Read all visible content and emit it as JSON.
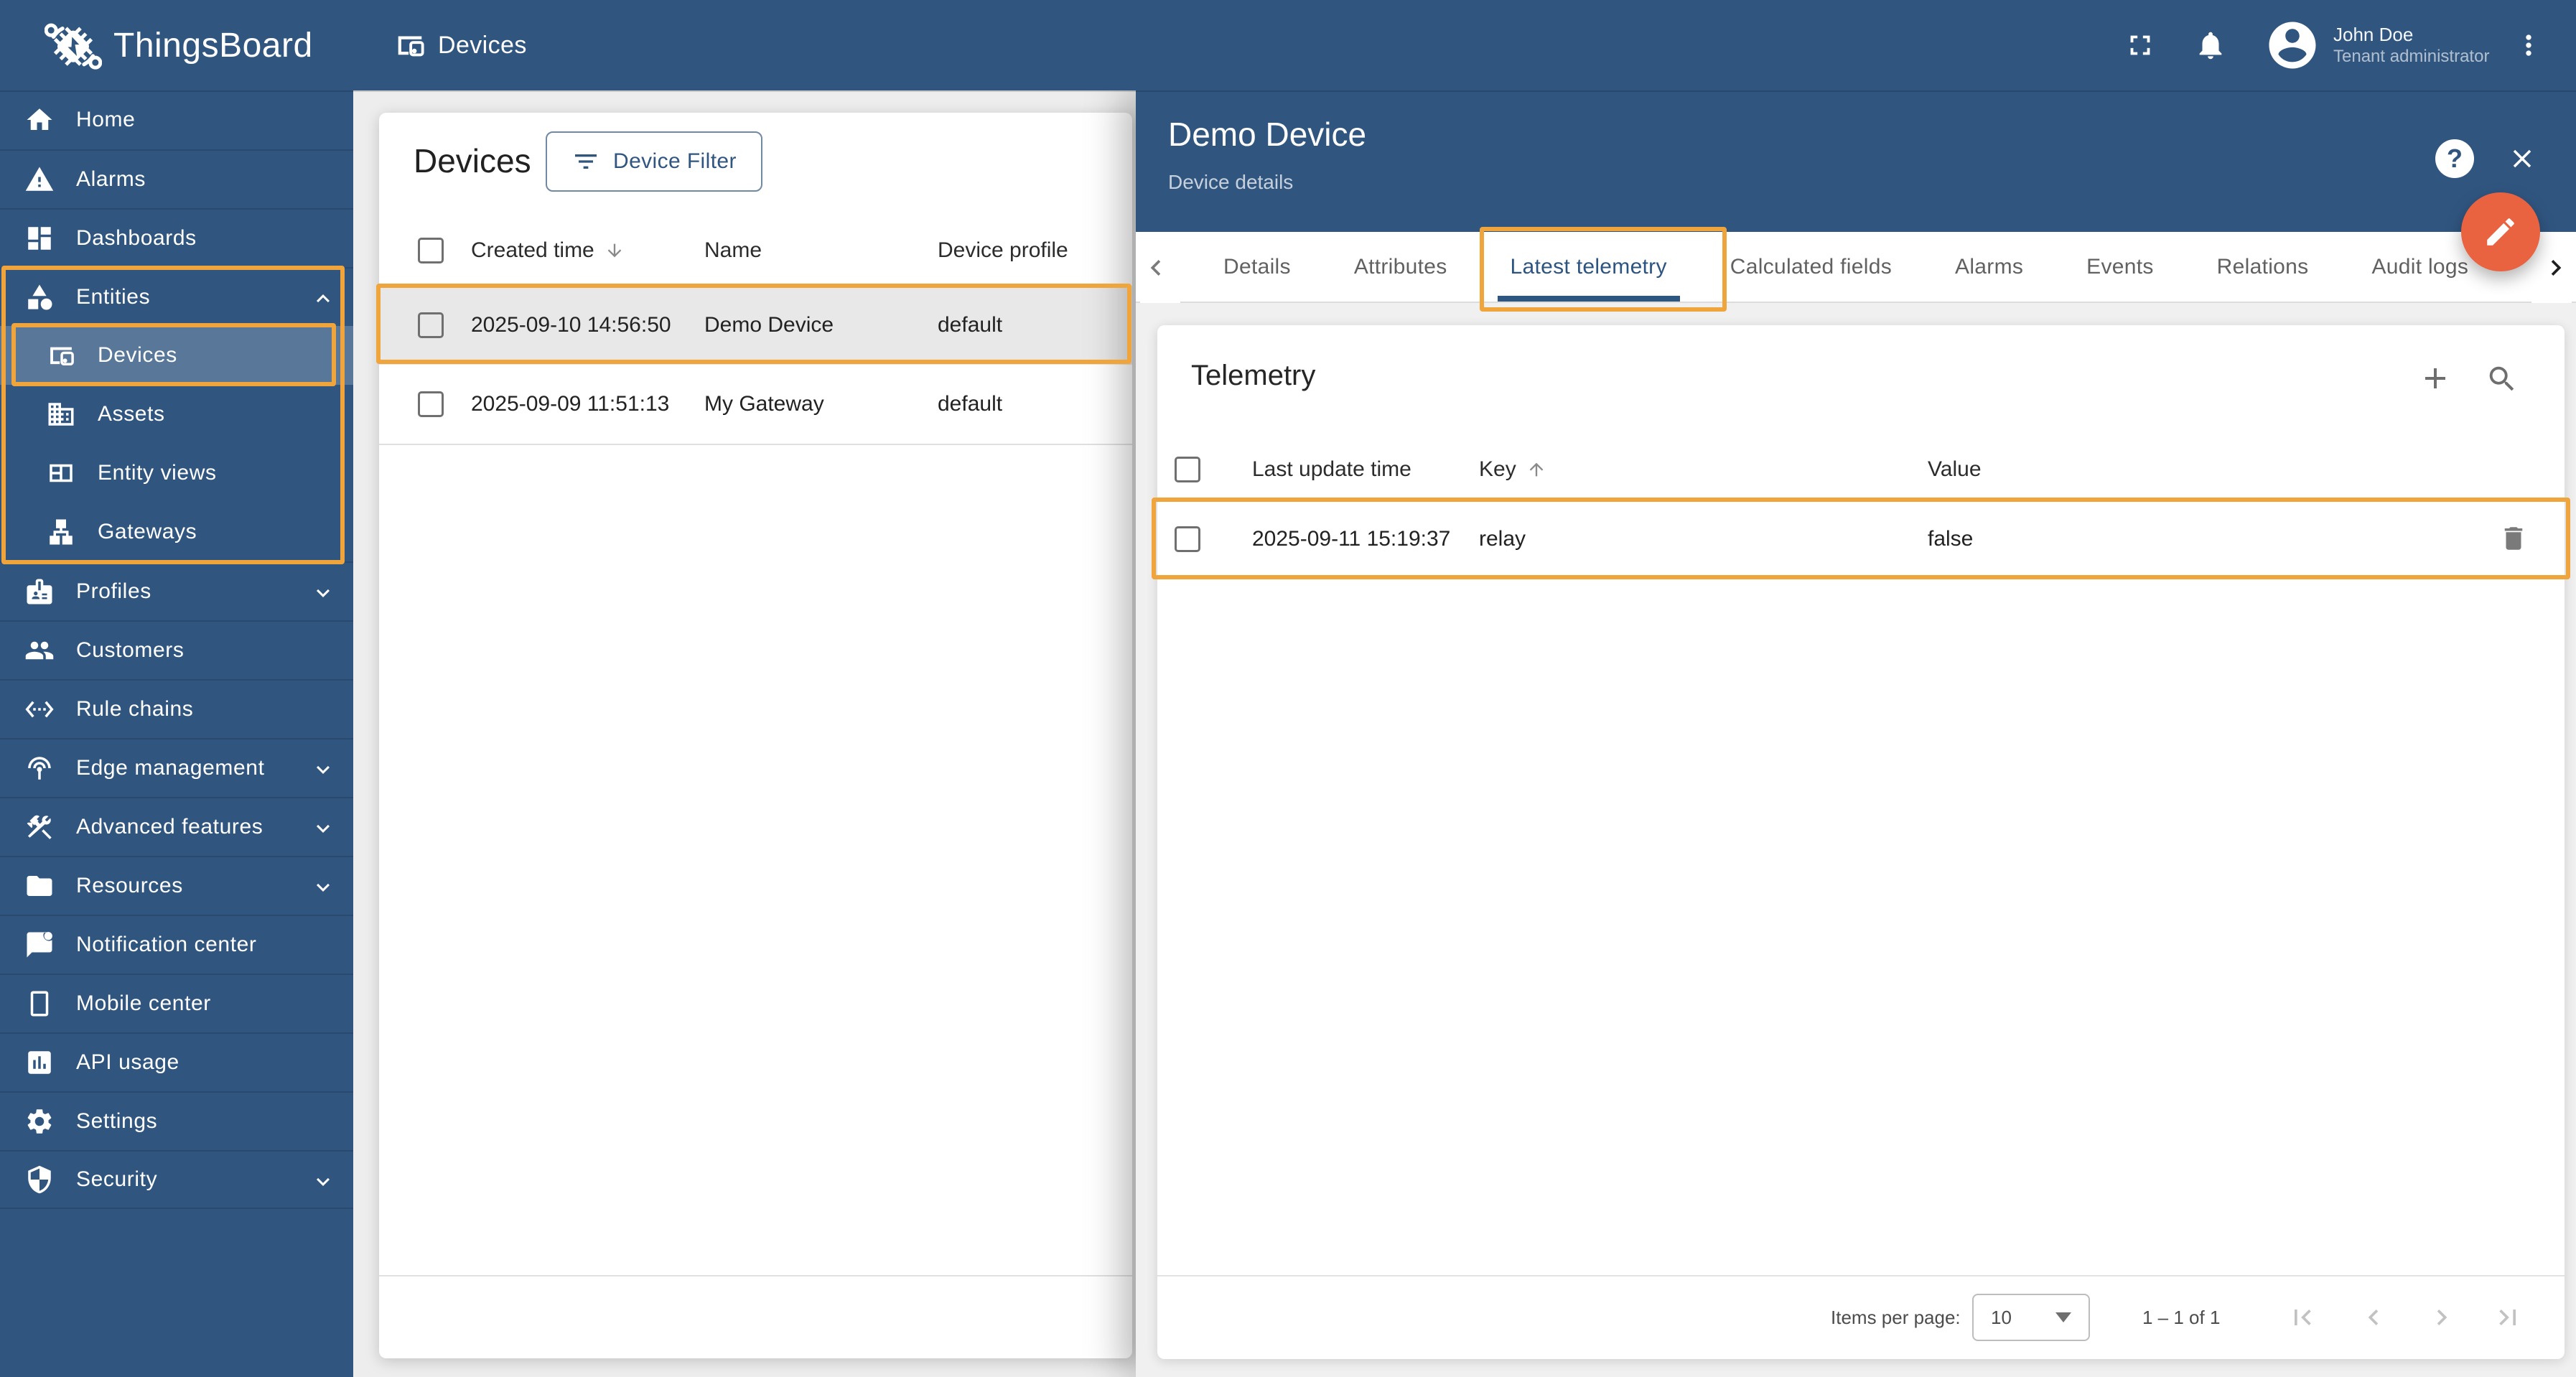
{
  "app": {
    "colors": {
      "primary": "#305680",
      "fab_orange": "#e96340",
      "annotation_orange": "#efa43c"
    }
  },
  "header": {
    "logo_text": "ThingsBoard",
    "breadcrumb": "Devices",
    "user": {
      "name": "John Doe",
      "role": "Tenant administrator"
    }
  },
  "sidebar": {
    "items": [
      {
        "label": "Home"
      },
      {
        "label": "Alarms"
      },
      {
        "label": "Dashboards"
      },
      {
        "label": "Entities"
      },
      {
        "label": "Devices"
      },
      {
        "label": "Assets"
      },
      {
        "label": "Entity views"
      },
      {
        "label": "Gateways"
      },
      {
        "label": "Profiles"
      },
      {
        "label": "Customers"
      },
      {
        "label": "Rule chains"
      },
      {
        "label": "Edge management"
      },
      {
        "label": "Advanced features"
      },
      {
        "label": "Resources"
      },
      {
        "label": "Notification center"
      },
      {
        "label": "Mobile center"
      },
      {
        "label": "API usage"
      },
      {
        "label": "Settings"
      },
      {
        "label": "Security"
      }
    ]
  },
  "devices_panel": {
    "title": "Devices",
    "filter_button": "Device Filter",
    "columns": {
      "created": "Created time",
      "name": "Name",
      "profile": "Device profile"
    },
    "rows": [
      {
        "created_time": "2025-09-10 14:56:50",
        "name": "Demo Device",
        "profile": "default"
      },
      {
        "created_time": "2025-09-09 11:51:13",
        "name": "My Gateway",
        "profile": "default"
      }
    ]
  },
  "details_panel": {
    "title": "Demo Device",
    "subtitle": "Device details",
    "help_glyph": "?",
    "tabs": [
      {
        "label": "Details"
      },
      {
        "label": "Attributes"
      },
      {
        "label": "Latest telemetry"
      },
      {
        "label": "Calculated fields"
      },
      {
        "label": "Alarms"
      },
      {
        "label": "Events"
      },
      {
        "label": "Relations"
      },
      {
        "label": "Audit logs"
      }
    ],
    "active_tab": "Latest telemetry",
    "telemetry": {
      "title": "Telemetry",
      "columns": {
        "time": "Last update time",
        "key": "Key",
        "value": "Value"
      },
      "rows": [
        {
          "time": "2025-09-11 15:19:37",
          "key": "relay",
          "value": "false"
        }
      ]
    },
    "pagination": {
      "label": "Items per page:",
      "size": "10",
      "range": "1 – 1 of 1"
    }
  }
}
